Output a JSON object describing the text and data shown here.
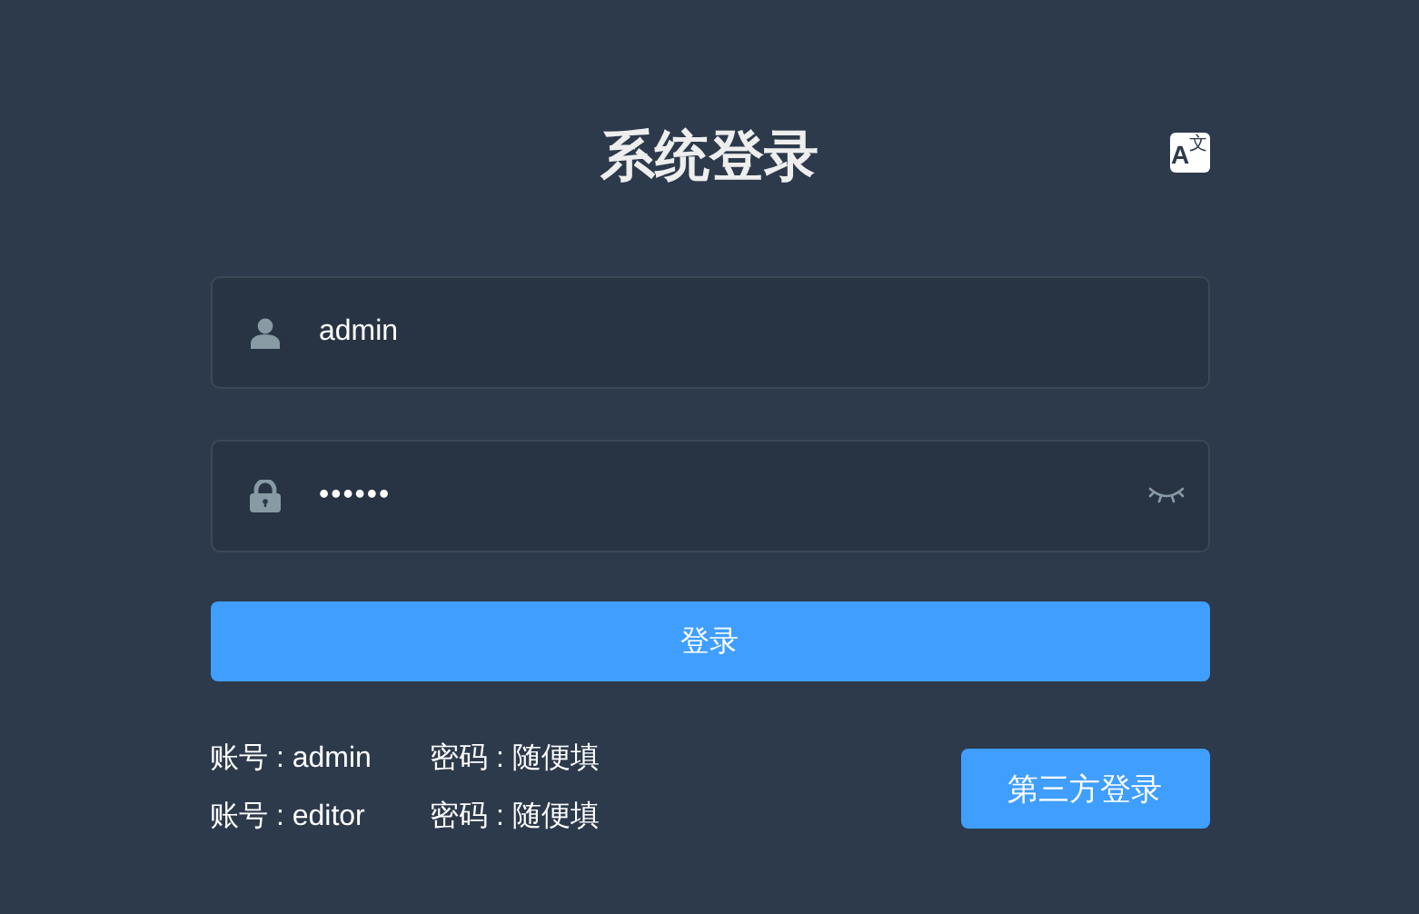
{
  "title": "系统登录",
  "language_button": {
    "letter": "A",
    "sup": "文"
  },
  "fields": [
    {
      "kind": "user",
      "value": "admin",
      "reveal_toggle": false
    },
    {
      "kind": "password",
      "value": "••••••",
      "reveal_toggle": true
    }
  ],
  "login_button": "登录",
  "tips": [
    {
      "account": "账号 : admin",
      "password": "密码 : 随便填"
    },
    {
      "account": "账号 : editor",
      "password": "密码 : 随便填"
    }
  ],
  "third_party_button": "第三方登录"
}
